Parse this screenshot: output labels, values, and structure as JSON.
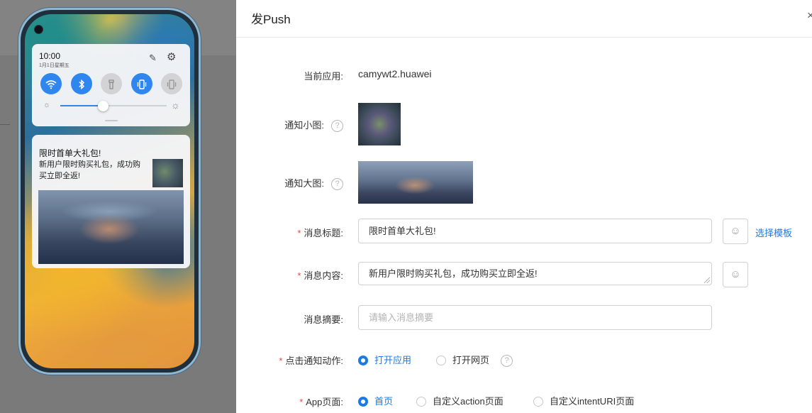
{
  "phone": {
    "time": "10:00",
    "date": "1月1日星期五",
    "tiles": [
      {
        "icon": "wifi-icon",
        "glyph": "◠"
      },
      {
        "icon": "bluetooth-icon",
        "glyph": "ᛒ"
      },
      {
        "icon": "flashlight-icon",
        "glyph": "▮"
      },
      {
        "icon": "vibrate-icon",
        "glyph": "▯"
      },
      {
        "icon": "auto-rotate-icon",
        "glyph": "▯"
      }
    ],
    "brightness_level": 0.4,
    "notification": {
      "title": "限时首单大礼包!",
      "body": "新用户限时购买礼包，成功购买立即全返!"
    }
  },
  "dialog": {
    "title": "发Push",
    "close_glyph": "×",
    "app": {
      "label": "当前应用:",
      "value": "camywt2.huawei"
    },
    "small_image": {
      "label": "通知小图:"
    },
    "large_image": {
      "label": "通知大图:"
    },
    "help_glyph": "?",
    "required_mark": "*",
    "emoji_glyph": "☺",
    "msg_title": {
      "label": "消息标题:",
      "value": "限时首单大礼包!",
      "link": "选择模板"
    },
    "msg_content": {
      "label": "消息内容:",
      "value": "新用户限时购买礼包，成功购买立即全返!"
    },
    "msg_summary": {
      "label": "消息摘要:",
      "placeholder": "请输入消息摘要"
    },
    "click_action": {
      "label": "点击通知动作:",
      "options": [
        "打开应用",
        "打开网页"
      ],
      "selected": 0
    },
    "app_page": {
      "label": "App页面:",
      "options": [
        "首页",
        "自定义action页面",
        "自定义intentURI页面"
      ],
      "selected": 0
    }
  }
}
